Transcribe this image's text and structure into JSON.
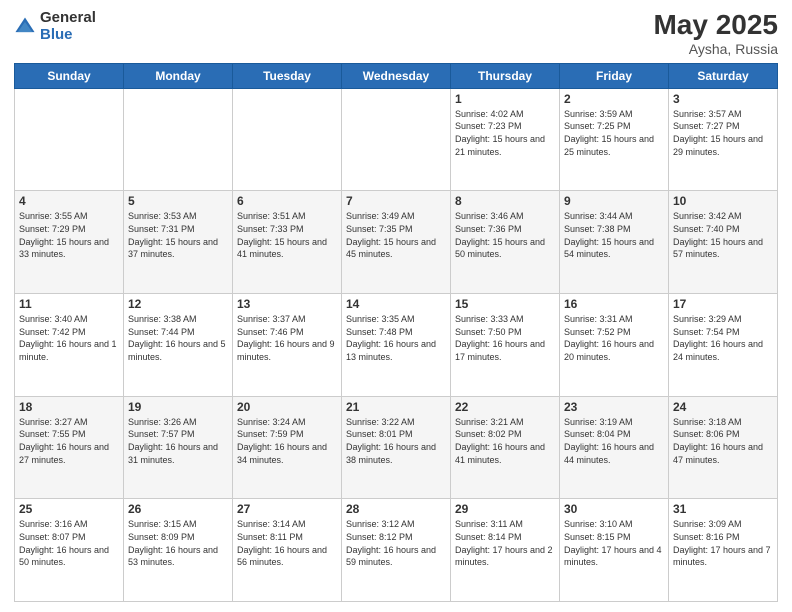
{
  "logo": {
    "general": "General",
    "blue": "Blue"
  },
  "header": {
    "month_year": "May 2025",
    "location": "Aysha, Russia"
  },
  "days_of_week": [
    "Sunday",
    "Monday",
    "Tuesday",
    "Wednesday",
    "Thursday",
    "Friday",
    "Saturday"
  ],
  "weeks": [
    [
      {
        "day": "",
        "info": ""
      },
      {
        "day": "",
        "info": ""
      },
      {
        "day": "",
        "info": ""
      },
      {
        "day": "",
        "info": ""
      },
      {
        "day": "1",
        "info": "Sunrise: 4:02 AM\nSunset: 7:23 PM\nDaylight: 15 hours\nand 21 minutes."
      },
      {
        "day": "2",
        "info": "Sunrise: 3:59 AM\nSunset: 7:25 PM\nDaylight: 15 hours\nand 25 minutes."
      },
      {
        "day": "3",
        "info": "Sunrise: 3:57 AM\nSunset: 7:27 PM\nDaylight: 15 hours\nand 29 minutes."
      }
    ],
    [
      {
        "day": "4",
        "info": "Sunrise: 3:55 AM\nSunset: 7:29 PM\nDaylight: 15 hours\nand 33 minutes."
      },
      {
        "day": "5",
        "info": "Sunrise: 3:53 AM\nSunset: 7:31 PM\nDaylight: 15 hours\nand 37 minutes."
      },
      {
        "day": "6",
        "info": "Sunrise: 3:51 AM\nSunset: 7:33 PM\nDaylight: 15 hours\nand 41 minutes."
      },
      {
        "day": "7",
        "info": "Sunrise: 3:49 AM\nSunset: 7:35 PM\nDaylight: 15 hours\nand 45 minutes."
      },
      {
        "day": "8",
        "info": "Sunrise: 3:46 AM\nSunset: 7:36 PM\nDaylight: 15 hours\nand 50 minutes."
      },
      {
        "day": "9",
        "info": "Sunrise: 3:44 AM\nSunset: 7:38 PM\nDaylight: 15 hours\nand 54 minutes."
      },
      {
        "day": "10",
        "info": "Sunrise: 3:42 AM\nSunset: 7:40 PM\nDaylight: 15 hours\nand 57 minutes."
      }
    ],
    [
      {
        "day": "11",
        "info": "Sunrise: 3:40 AM\nSunset: 7:42 PM\nDaylight: 16 hours\nand 1 minute."
      },
      {
        "day": "12",
        "info": "Sunrise: 3:38 AM\nSunset: 7:44 PM\nDaylight: 16 hours\nand 5 minutes."
      },
      {
        "day": "13",
        "info": "Sunrise: 3:37 AM\nSunset: 7:46 PM\nDaylight: 16 hours\nand 9 minutes."
      },
      {
        "day": "14",
        "info": "Sunrise: 3:35 AM\nSunset: 7:48 PM\nDaylight: 16 hours\nand 13 minutes."
      },
      {
        "day": "15",
        "info": "Sunrise: 3:33 AM\nSunset: 7:50 PM\nDaylight: 16 hours\nand 17 minutes."
      },
      {
        "day": "16",
        "info": "Sunrise: 3:31 AM\nSunset: 7:52 PM\nDaylight: 16 hours\nand 20 minutes."
      },
      {
        "day": "17",
        "info": "Sunrise: 3:29 AM\nSunset: 7:54 PM\nDaylight: 16 hours\nand 24 minutes."
      }
    ],
    [
      {
        "day": "18",
        "info": "Sunrise: 3:27 AM\nSunset: 7:55 PM\nDaylight: 16 hours\nand 27 minutes."
      },
      {
        "day": "19",
        "info": "Sunrise: 3:26 AM\nSunset: 7:57 PM\nDaylight: 16 hours\nand 31 minutes."
      },
      {
        "day": "20",
        "info": "Sunrise: 3:24 AM\nSunset: 7:59 PM\nDaylight: 16 hours\nand 34 minutes."
      },
      {
        "day": "21",
        "info": "Sunrise: 3:22 AM\nSunset: 8:01 PM\nDaylight: 16 hours\nand 38 minutes."
      },
      {
        "day": "22",
        "info": "Sunrise: 3:21 AM\nSunset: 8:02 PM\nDaylight: 16 hours\nand 41 minutes."
      },
      {
        "day": "23",
        "info": "Sunrise: 3:19 AM\nSunset: 8:04 PM\nDaylight: 16 hours\nand 44 minutes."
      },
      {
        "day": "24",
        "info": "Sunrise: 3:18 AM\nSunset: 8:06 PM\nDaylight: 16 hours\nand 47 minutes."
      }
    ],
    [
      {
        "day": "25",
        "info": "Sunrise: 3:16 AM\nSunset: 8:07 PM\nDaylight: 16 hours\nand 50 minutes."
      },
      {
        "day": "26",
        "info": "Sunrise: 3:15 AM\nSunset: 8:09 PM\nDaylight: 16 hours\nand 53 minutes."
      },
      {
        "day": "27",
        "info": "Sunrise: 3:14 AM\nSunset: 8:11 PM\nDaylight: 16 hours\nand 56 minutes."
      },
      {
        "day": "28",
        "info": "Sunrise: 3:12 AM\nSunset: 8:12 PM\nDaylight: 16 hours\nand 59 minutes."
      },
      {
        "day": "29",
        "info": "Sunrise: 3:11 AM\nSunset: 8:14 PM\nDaylight: 17 hours\nand 2 minutes."
      },
      {
        "day": "30",
        "info": "Sunrise: 3:10 AM\nSunset: 8:15 PM\nDaylight: 17 hours\nand 4 minutes."
      },
      {
        "day": "31",
        "info": "Sunrise: 3:09 AM\nSunset: 8:16 PM\nDaylight: 17 hours\nand 7 minutes."
      }
    ]
  ]
}
